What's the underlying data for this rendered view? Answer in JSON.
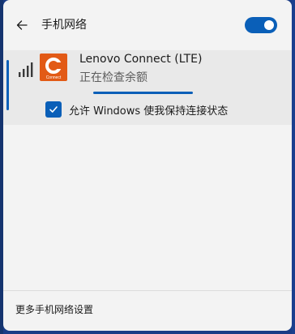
{
  "header": {
    "title": "手机网络",
    "back_icon": "arrow-left-icon",
    "toggle_on": true
  },
  "network": {
    "name": "Lenovo Connect (LTE)",
    "status": "正在检查余额",
    "signal_icon": "cellular-signal-icon",
    "logo_icon": "lenovo-connect-logo-icon",
    "logo_text": "Connect",
    "progress": 0.7
  },
  "option": {
    "checked": true,
    "label": "允许 Windows 使我保持连接状态"
  },
  "footer": {
    "link_label": "更多手机网络设置"
  },
  "colors": {
    "accent": "#0a5fb8",
    "panel": "#f3f3f3",
    "selected_item": "#e9e9e9",
    "logo": "#e25a16"
  }
}
